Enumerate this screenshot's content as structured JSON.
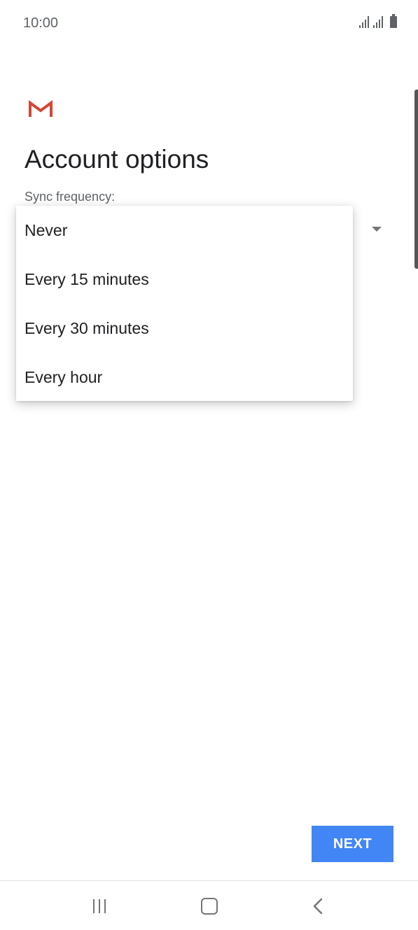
{
  "status_bar": {
    "time": "10:00",
    "icons": [
      "signal-icon",
      "signal-icon",
      "battery-icon"
    ]
  },
  "app": {
    "logo_icon": "gmail-logo-icon",
    "title": "Account options"
  },
  "sync": {
    "label": "Sync frequency:",
    "options": [
      "Never",
      "Every 15 minutes",
      "Every 30 minutes",
      "Every hour"
    ]
  },
  "actions": {
    "next_label": "NEXT"
  },
  "colors": {
    "accent": "#4285f4",
    "gmail_red": "#d44638"
  },
  "nav_bar": {
    "icons": [
      "recents-icon",
      "home-icon",
      "back-icon"
    ]
  }
}
